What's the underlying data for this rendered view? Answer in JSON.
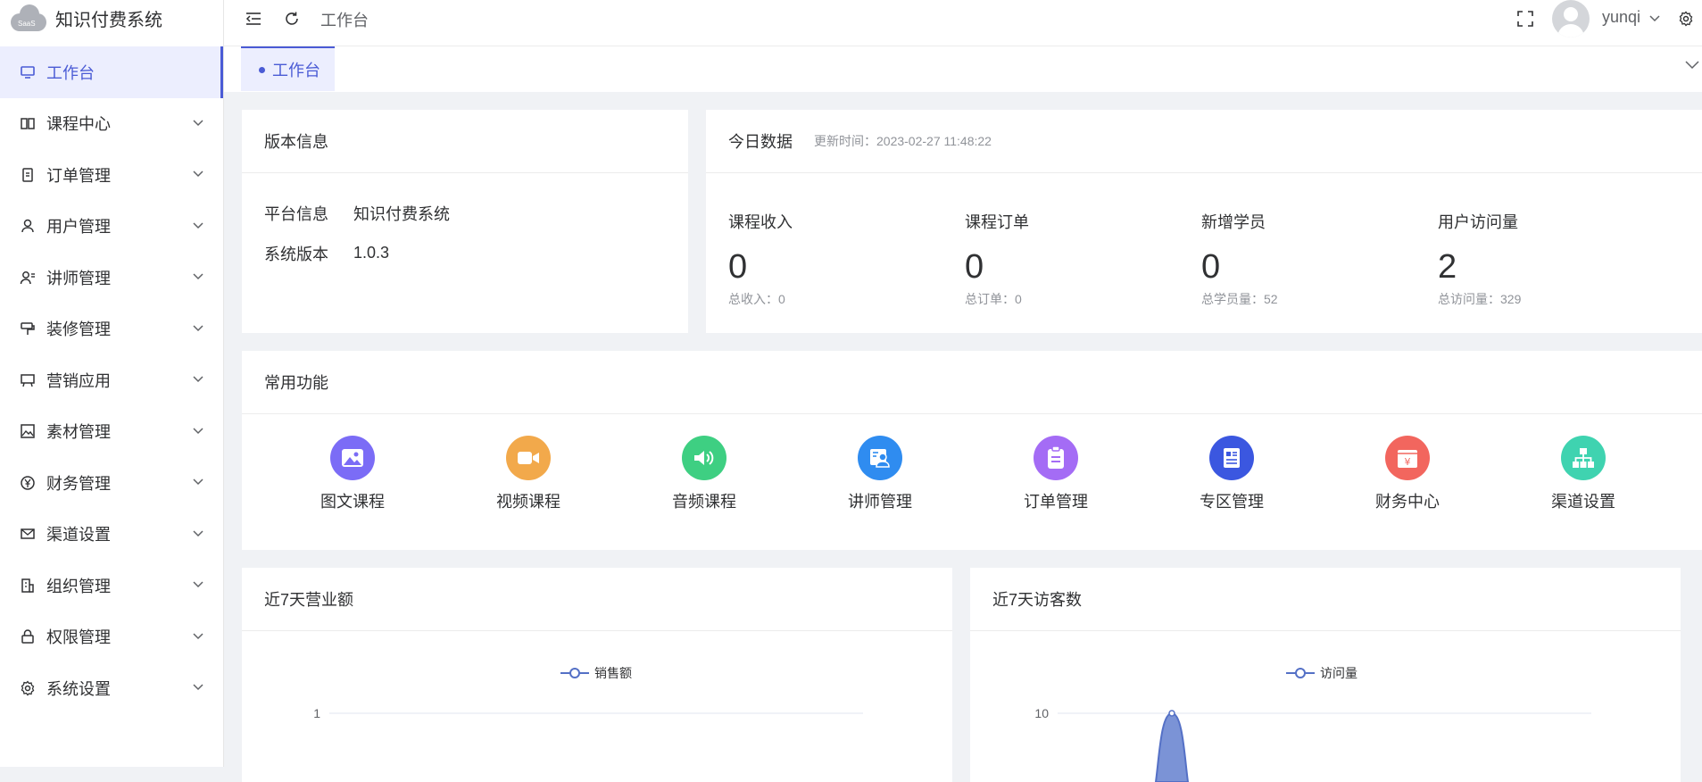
{
  "app": {
    "logo_text": "SaaS",
    "title": "知识付费系统"
  },
  "menu": [
    {
      "label": "工作台",
      "icon": "monitor-icon",
      "active": true
    },
    {
      "label": "课程中心",
      "icon": "book-icon"
    },
    {
      "label": "订单管理",
      "icon": "order-icon"
    },
    {
      "label": "用户管理",
      "icon": "user-icon"
    },
    {
      "label": "讲师管理",
      "icon": "teacher-icon"
    },
    {
      "label": "装修管理",
      "icon": "paint-icon"
    },
    {
      "label": "营销应用",
      "icon": "board-icon"
    },
    {
      "label": "素材管理",
      "icon": "image-icon"
    },
    {
      "label": "财务管理",
      "icon": "yen-icon"
    },
    {
      "label": "渠道设置",
      "icon": "mail-icon"
    },
    {
      "label": "组织管理",
      "icon": "building-icon"
    },
    {
      "label": "权限管理",
      "icon": "lock-icon"
    },
    {
      "label": "系统设置",
      "icon": "gear-icon"
    }
  ],
  "header": {
    "breadcrumb": "工作台",
    "username": "yunqi"
  },
  "tabs": [
    {
      "label": "工作台"
    }
  ],
  "version_card": {
    "title": "版本信息",
    "rows": [
      {
        "key": "平台信息",
        "value": "知识付费系统"
      },
      {
        "key": "系统版本",
        "value": "1.0.3"
      }
    ]
  },
  "today_card": {
    "title": "今日数据",
    "updated": "更新时间：2023-02-27 11:48:22",
    "stats": [
      {
        "label": "课程收入",
        "value": "0",
        "sub": "总收入：0"
      },
      {
        "label": "课程订单",
        "value": "0",
        "sub": "总订单：0"
      },
      {
        "label": "新增学员",
        "value": "0",
        "sub": "总学员量：52"
      },
      {
        "label": "用户访问量",
        "value": "2",
        "sub": "总访问量：329"
      }
    ]
  },
  "functions_card": {
    "title": "常用功能",
    "items": [
      {
        "label": "图文课程",
        "icon": "picture-icon",
        "color": "#7b6cf6"
      },
      {
        "label": "视频课程",
        "icon": "video-icon",
        "color": "#f2a94b"
      },
      {
        "label": "音频课程",
        "icon": "audio-icon",
        "color": "#3ecf82"
      },
      {
        "label": "讲师管理",
        "icon": "lecturer-icon",
        "color": "#2f8cf0"
      },
      {
        "label": "订单管理",
        "icon": "clipboard-icon",
        "color": "#a46cf5"
      },
      {
        "label": "专区管理",
        "icon": "newspaper-icon",
        "color": "#3b57e0"
      },
      {
        "label": "财务中心",
        "icon": "finance-icon",
        "color": "#f2665e"
      },
      {
        "label": "渠道设置",
        "icon": "hierarchy-icon",
        "color": "#3fd3b0"
      }
    ]
  },
  "sales_chart": {
    "title": "近7天营业额",
    "chart_data": {
      "type": "area",
      "legend": "销售额",
      "y_ticks": [
        "1"
      ],
      "color": "#5470c6"
    }
  },
  "visitor_chart": {
    "title": "近7天访客数",
    "chart_data": {
      "type": "area",
      "legend": "访问量",
      "y_ticks": [
        "10"
      ],
      "color": "#5470c6"
    }
  }
}
